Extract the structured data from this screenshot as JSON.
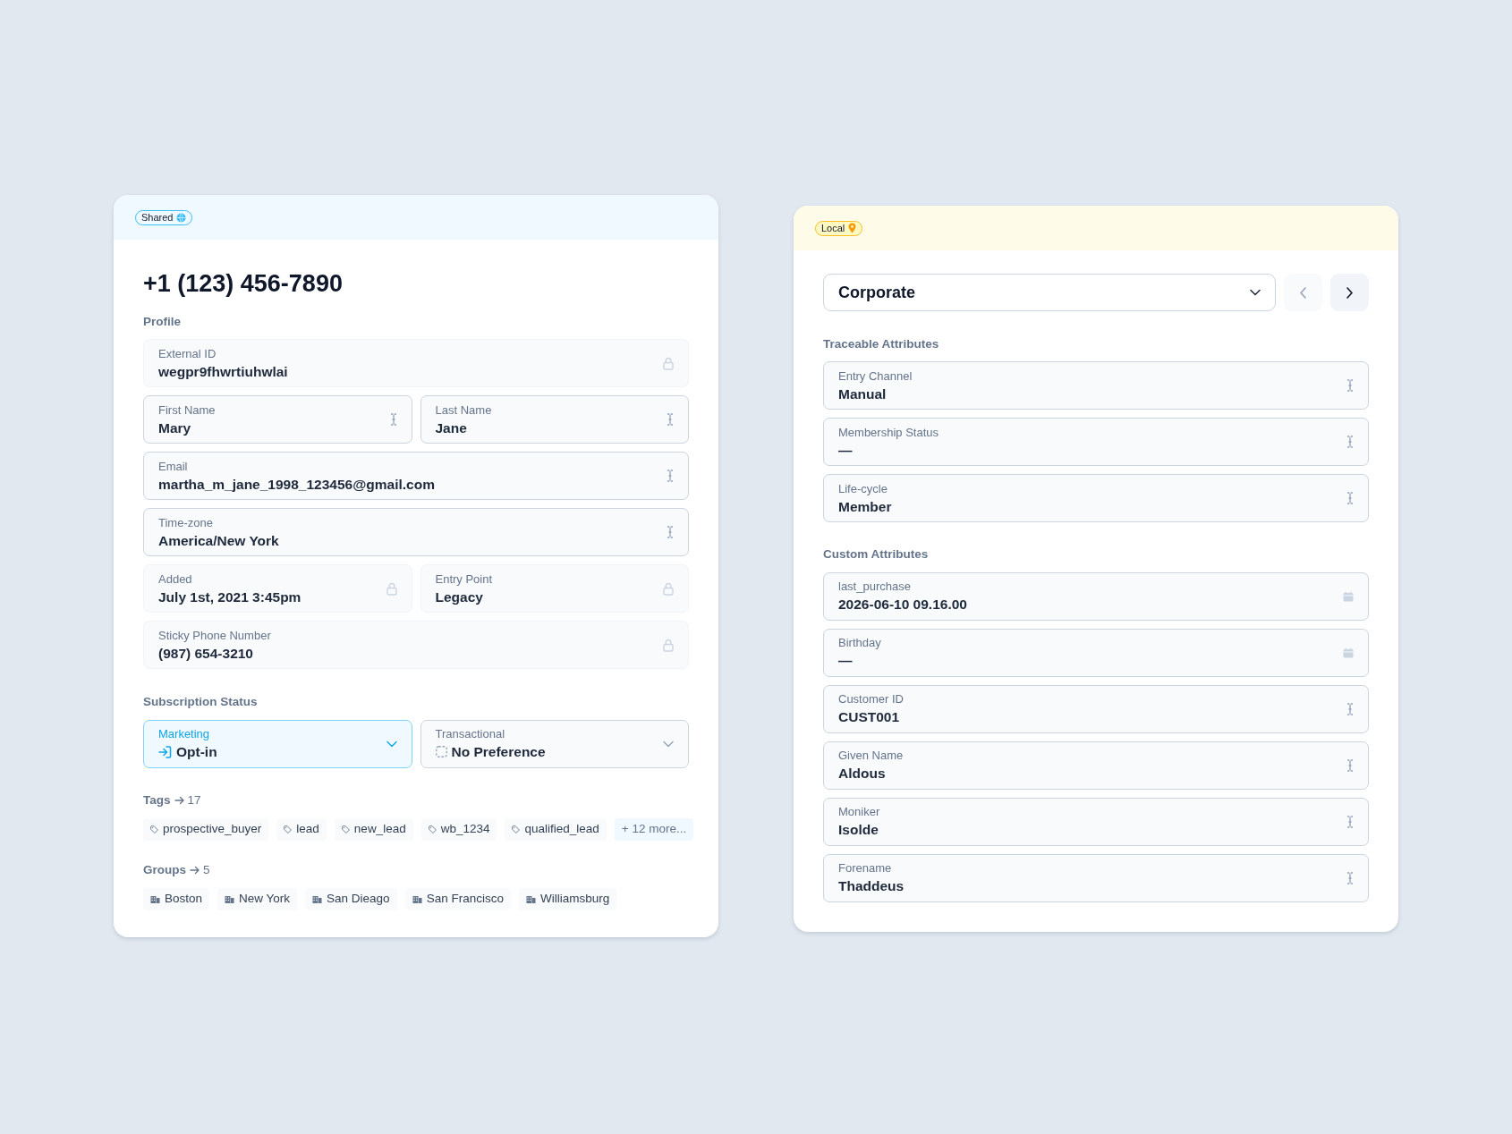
{
  "shared_card": {
    "badge": "Shared",
    "title": "+1 (123) 456-7890",
    "profile": {
      "heading": "Profile",
      "rows": [
        [
          {
            "label": "External ID",
            "value": "wegpr9fhwrtiuhwlai",
            "kind": "locked"
          }
        ],
        [
          {
            "label": "First Name",
            "value": "Mary",
            "kind": "text"
          },
          {
            "label": "Last Name",
            "value": "Jane",
            "kind": "text"
          }
        ],
        [
          {
            "label": "Email",
            "value": "martha_m_jane_1998_123456@gmail.com",
            "kind": "text"
          }
        ],
        [
          {
            "label": "Time-zone",
            "value": "America/New York",
            "kind": "text"
          }
        ],
        [
          {
            "label": "Added",
            "value": "July 1st, 2021 3:45pm",
            "kind": "locked"
          },
          {
            "label": "Entry Point",
            "value": "Legacy",
            "kind": "locked"
          }
        ],
        [
          {
            "label": "Sticky Phone Number",
            "value": "(987) 654-3210",
            "kind": "locked"
          }
        ]
      ]
    },
    "subscription": {
      "heading": "Subscription Status",
      "selects": [
        {
          "label": "Marketing",
          "value": "Opt-in",
          "kind": "opt_in",
          "active": true
        },
        {
          "label": "Transactional",
          "value": "No Preference",
          "kind": "none",
          "active": false
        }
      ]
    },
    "tags": {
      "heading": "Tags",
      "count": "17",
      "items": [
        "prospective_buyer",
        "lead",
        "new_lead",
        "wb_1234",
        "qualified_lead"
      ],
      "more": "+ 12 more..."
    },
    "groups": {
      "heading": "Groups",
      "count": "5",
      "items": [
        "Boston",
        "New York",
        "San Dieago",
        "San Francisco",
        "Williamsburg"
      ]
    }
  },
  "local_card": {
    "badge": "Local",
    "select": "Corporate",
    "prev_disabled": true,
    "next_disabled": false,
    "sections": [
      {
        "heading": "Traceable Attributes",
        "fields": [
          {
            "label": "Entry Channel",
            "value": "Manual",
            "kind": "text"
          },
          {
            "label": "Membership Status",
            "value": "—",
            "kind": "text"
          },
          {
            "label": "Life-cycle",
            "value": "Member",
            "kind": "text"
          }
        ]
      },
      {
        "heading": "Custom Attributes",
        "fields": [
          {
            "label": "last_purchase",
            "value": "2026-06-10 09.16.00",
            "kind": "date"
          },
          {
            "label": "Birthday",
            "value": "—",
            "kind": "date"
          },
          {
            "label": "Customer ID",
            "value": "CUST001",
            "kind": "text"
          },
          {
            "label": "Given Name",
            "value": "Aldous",
            "kind": "text"
          },
          {
            "label": "Moniker",
            "value": "Isolde",
            "kind": "text"
          },
          {
            "label": "Forename",
            "value": "Thaddeus",
            "kind": "text"
          }
        ]
      }
    ]
  }
}
